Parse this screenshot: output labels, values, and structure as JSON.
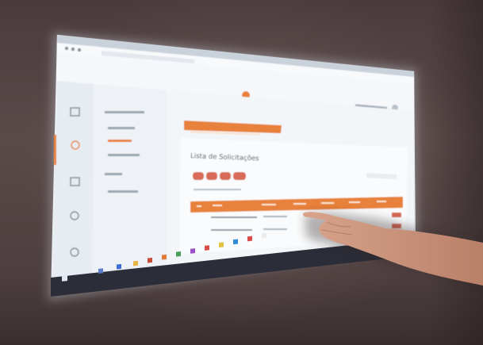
{
  "screen": {
    "content_title": "Lista de Solicitações",
    "breadcrumb_pill": "",
    "logo_text": "",
    "sidebar_section_a": "",
    "sidebar_section_b": "",
    "sidebar_items": [
      "",
      "",
      "",
      ""
    ],
    "table": {
      "headers": [
        "",
        "",
        "",
        "",
        "",
        "",
        ""
      ],
      "rows": [
        [
          "",
          "",
          ""
        ],
        [
          "",
          "",
          ""
        ]
      ]
    }
  },
  "taskbar": {
    "icons": [
      "start-icon",
      "search-icon",
      "app-icon",
      "app-icon",
      "app-icon",
      "app-icon",
      "app-icon",
      "app-icon",
      "app-icon",
      "app-icon",
      "app-icon",
      "app-icon",
      "app-icon",
      "app-icon",
      "app-icon",
      "app-icon",
      "app-icon"
    ]
  },
  "colors": {
    "accent": "#e8813a",
    "screen_bg": "#e9eef4",
    "sidebar_bg": "#dfe6ee",
    "wall": "#4f4040"
  }
}
